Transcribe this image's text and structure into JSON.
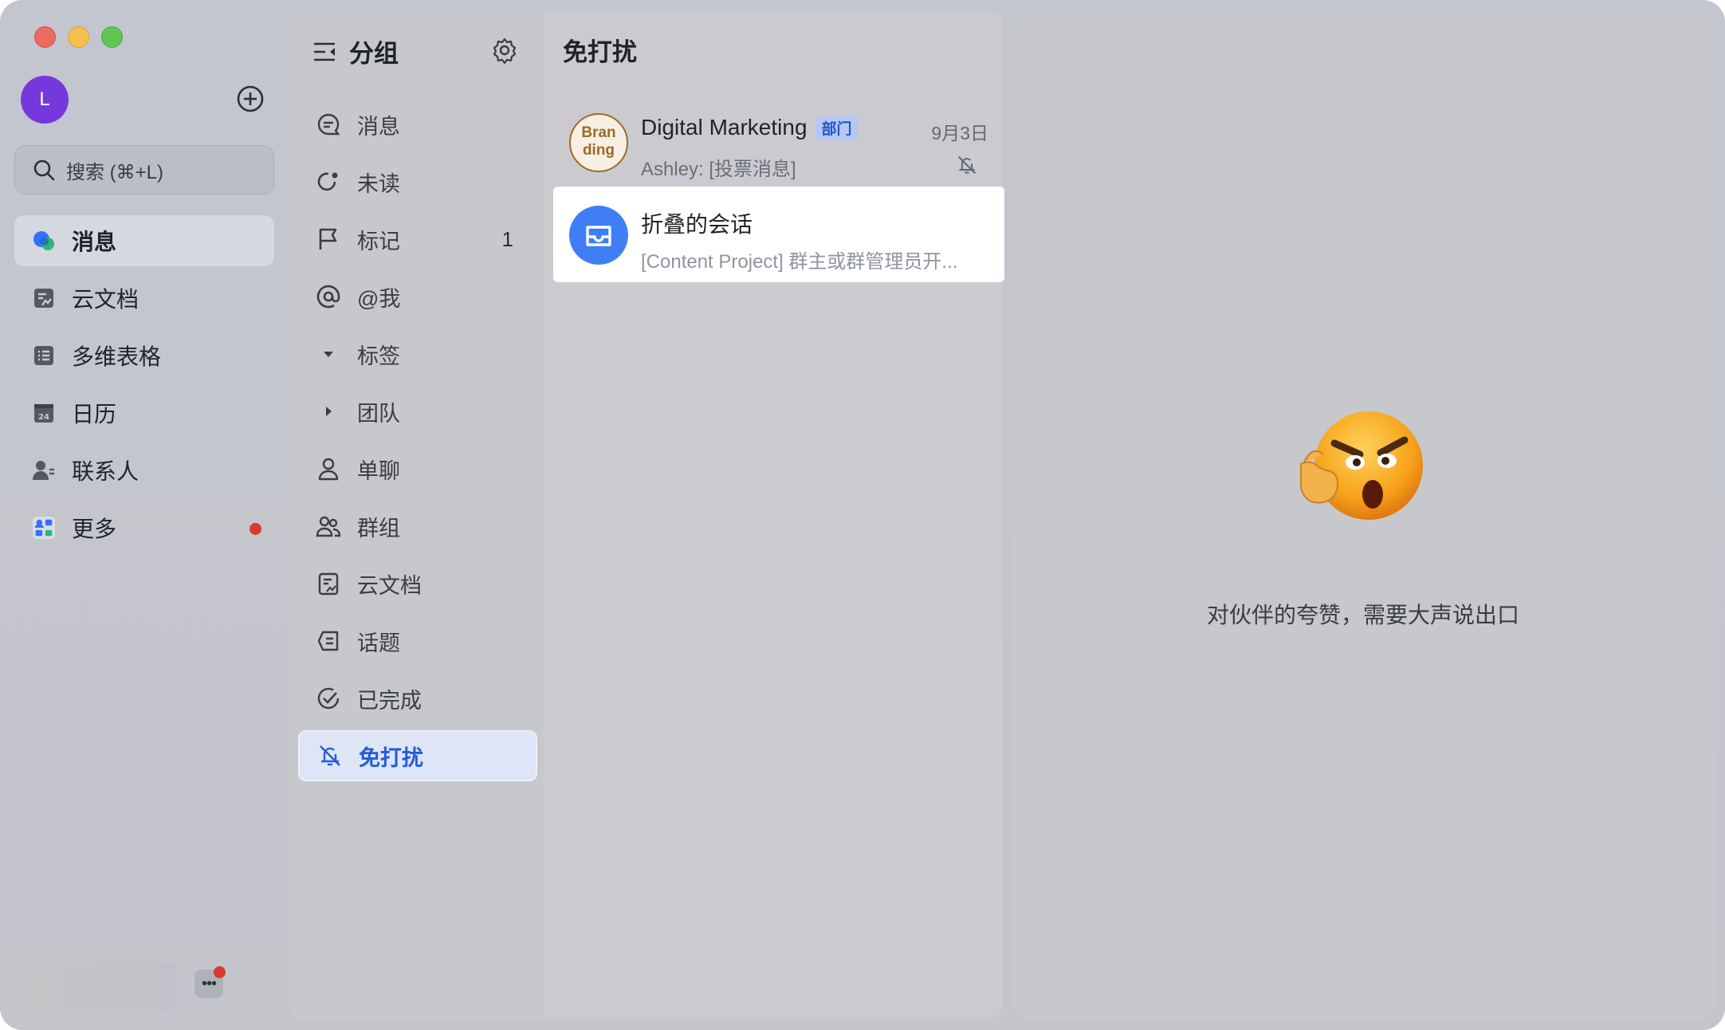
{
  "window": {
    "traffic_lights": [
      "close",
      "minimize",
      "maximize"
    ]
  },
  "user": {
    "avatar_initial": "L",
    "avatar_color": "#7538dd"
  },
  "search": {
    "placeholder": "搜索 (⌘+L)"
  },
  "nav": {
    "items": [
      {
        "label": "消息",
        "icon": "message-icon",
        "active": true
      },
      {
        "label": "云文档",
        "icon": "cloud-doc-icon"
      },
      {
        "label": "多维表格",
        "icon": "base-table-icon"
      },
      {
        "label": "日历",
        "icon": "calendar-icon",
        "icon_text": "24"
      },
      {
        "label": "联系人",
        "icon": "contacts-icon"
      },
      {
        "label": "更多",
        "icon": "more-apps-icon",
        "has_dot": true
      }
    ]
  },
  "groups": {
    "title": "分组",
    "items": [
      {
        "label": "消息",
        "icon": "chat-bubble-icon"
      },
      {
        "label": "未读",
        "icon": "unread-icon"
      },
      {
        "label": "标记",
        "icon": "flag-icon",
        "count": "1"
      },
      {
        "label": "@我",
        "icon": "at-icon"
      },
      {
        "label": "标签",
        "icon": "caret-down-icon"
      },
      {
        "label": "团队",
        "icon": "caret-right-icon"
      },
      {
        "label": "单聊",
        "icon": "person-icon"
      },
      {
        "label": "群组",
        "icon": "group-icon"
      },
      {
        "label": "云文档",
        "icon": "doc-icon"
      },
      {
        "label": "话题",
        "icon": "topic-icon"
      },
      {
        "label": "已完成",
        "icon": "check-circle-icon"
      },
      {
        "label": "免打扰",
        "icon": "bell-off-icon",
        "active": true
      }
    ]
  },
  "conversations": {
    "title": "免打扰",
    "items": [
      {
        "avatar_text": "Bran ding",
        "name": "Digital Marketing",
        "tag": "部门",
        "time": "9月3日",
        "preview": "Ashley: [投票消息]",
        "muted": true
      },
      {
        "name": "折叠的会话",
        "preview": "[Content Project] 群主或群管理员开...",
        "selected": true
      }
    ]
  },
  "detail": {
    "empty_text": "对伙伴的夸赞，需要大声说出口"
  },
  "colors": {
    "accent": "#245bdb",
    "active_group_bg": "#dde5f6",
    "badge_red": "#d83931"
  }
}
